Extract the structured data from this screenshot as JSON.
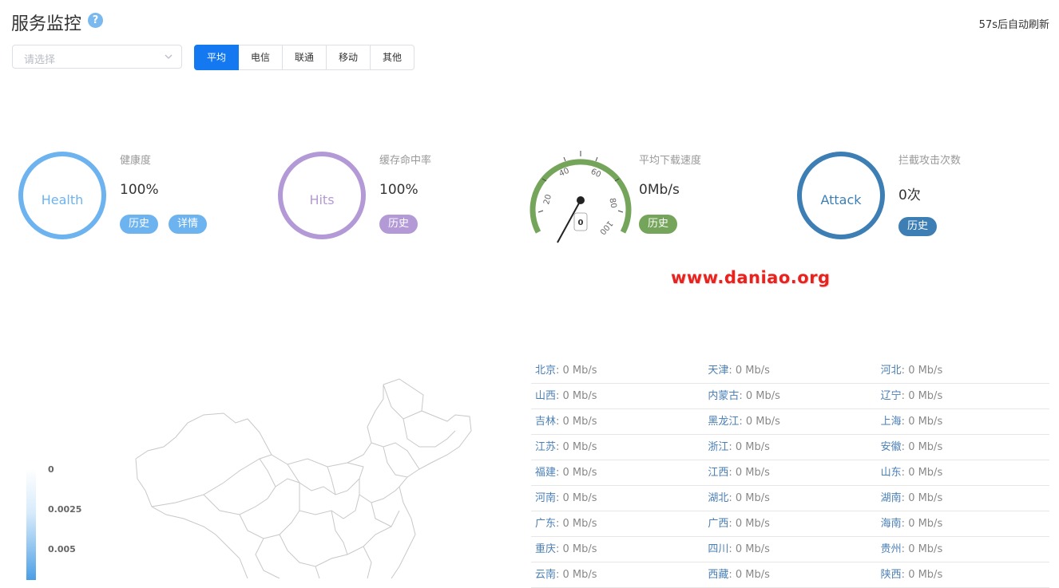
{
  "header": {
    "title": "服务监控",
    "help_icon": "?",
    "refresh_text": "57s后自动刷新"
  },
  "filter": {
    "placeholder": "请选择"
  },
  "tabs": [
    {
      "label": "平均",
      "active": true
    },
    {
      "label": "电信",
      "active": false
    },
    {
      "label": "联通",
      "active": false
    },
    {
      "label": "移动",
      "active": false
    },
    {
      "label": "其他",
      "active": false
    }
  ],
  "metrics": {
    "health": {
      "ring_text": "Health",
      "label": "健康度",
      "value": "100%",
      "history": "历史",
      "details": "详情",
      "color": "#6db3ef"
    },
    "hits": {
      "ring_text": "Hits",
      "label": "缓存命中率",
      "value": "100%",
      "history": "历史",
      "color": "#b39ad6"
    },
    "speed": {
      "label": "平均下载速度",
      "value": "0Mb/s",
      "history": "历史",
      "gauge_value": "0",
      "gauge_ticks": [
        "20",
        "40",
        "60",
        "80",
        "100"
      ],
      "color": "#74a55a"
    },
    "attack": {
      "ring_text": "Attack",
      "label": "拦截攻击次数",
      "value": "0次",
      "history": "历史",
      "color": "#3d7fb5"
    }
  },
  "watermark": "www.daniao.org",
  "map_legend": [
    "0",
    "0.0025",
    "0.005"
  ],
  "provinces": [
    [
      {
        "name": "北京",
        "value": "0 Mb/s"
      },
      {
        "name": "天津",
        "value": "0 Mb/s"
      },
      {
        "name": "河北",
        "value": "0 Mb/s"
      }
    ],
    [
      {
        "name": "山西",
        "value": "0 Mb/s"
      },
      {
        "name": "内蒙古",
        "value": "0 Mb/s"
      },
      {
        "name": "辽宁",
        "value": "0 Mb/s"
      }
    ],
    [
      {
        "name": "吉林",
        "value": "0 Mb/s"
      },
      {
        "name": "黑龙江",
        "value": "0 Mb/s"
      },
      {
        "name": "上海",
        "value": "0 Mb/s"
      }
    ],
    [
      {
        "name": "江苏",
        "value": "0 Mb/s"
      },
      {
        "name": "浙江",
        "value": "0 Mb/s"
      },
      {
        "name": "安徽",
        "value": "0 Mb/s"
      }
    ],
    [
      {
        "name": "福建",
        "value": "0 Mb/s"
      },
      {
        "name": "江西",
        "value": "0 Mb/s"
      },
      {
        "name": "山东",
        "value": "0 Mb/s"
      }
    ],
    [
      {
        "name": "河南",
        "value": "0 Mb/s"
      },
      {
        "name": "湖北",
        "value": "0 Mb/s"
      },
      {
        "name": "湖南",
        "value": "0 Mb/s"
      }
    ],
    [
      {
        "name": "广东",
        "value": "0 Mb/s"
      },
      {
        "name": "广西",
        "value": "0 Mb/s"
      },
      {
        "name": "海南",
        "value": "0 Mb/s"
      }
    ],
    [
      {
        "name": "重庆",
        "value": "0 Mb/s"
      },
      {
        "name": "四川",
        "value": "0 Mb/s"
      },
      {
        "name": "贵州",
        "value": "0 Mb/s"
      }
    ],
    [
      {
        "name": "云南",
        "value": "0 Mb/s"
      },
      {
        "name": "西藏",
        "value": "0 Mb/s"
      },
      {
        "name": "陕西",
        "value": "0 Mb/s"
      }
    ]
  ]
}
